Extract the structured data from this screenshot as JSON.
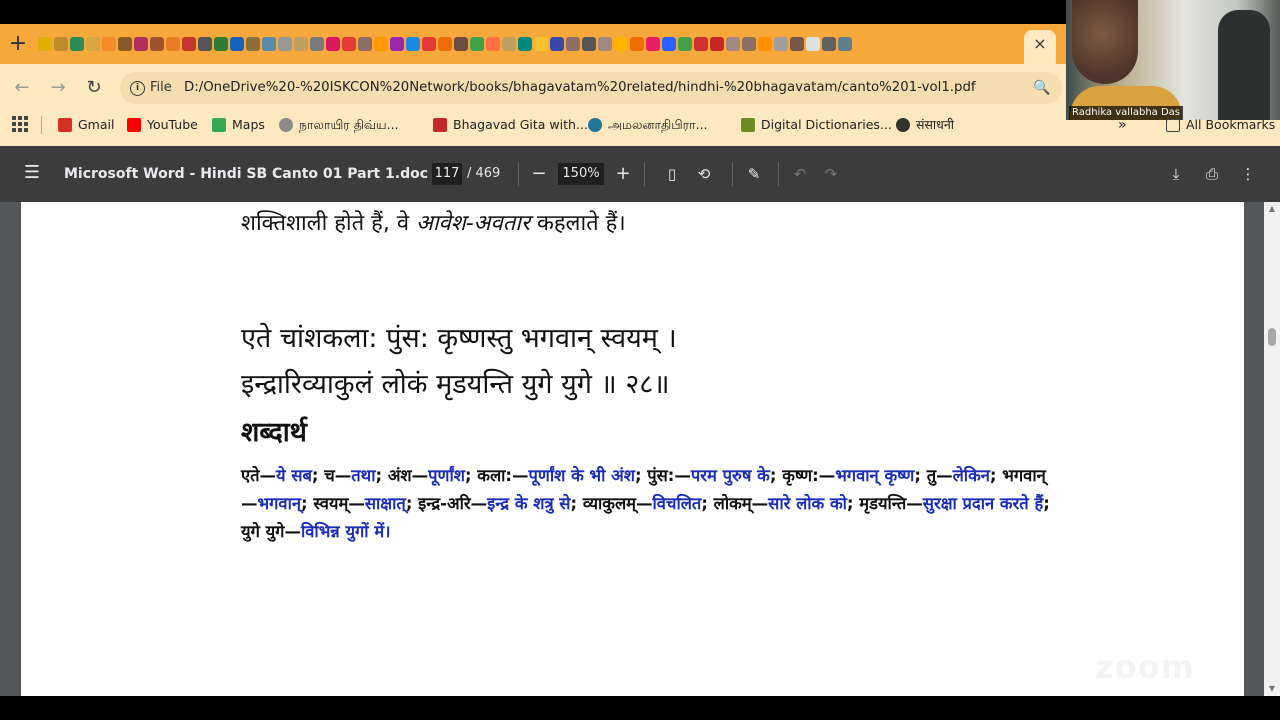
{
  "browser": {
    "tab_close": "×",
    "new_tab": "+",
    "address": {
      "chip_label": "File",
      "url": "D:/OneDrive%20-%20ISKCON%20Network/books/bhagavatam%20related/hindhi-%20bhagavatam/canto%201-vol1.pdf"
    },
    "bookmarks": [
      {
        "label": "Gmail",
        "icon": "gmail-icon",
        "color": "#d93025"
      },
      {
        "label": "YouTube",
        "icon": "youtube-icon",
        "color": "#ff0000"
      },
      {
        "label": "Maps",
        "icon": "maps-icon",
        "color": "#34a853"
      },
      {
        "label": "நாலாயிர திவ்ய...",
        "icon": "temple-icon",
        "color": "#8a8a8a"
      },
      {
        "label": "Bhagavad Gita with...",
        "icon": "flower-icon",
        "color": "#c62828"
      },
      {
        "label": "அமலனாதிபிரா...",
        "icon": "wordpress-icon",
        "color": "#21759b"
      },
      {
        "label": "Digital Dictionaries...",
        "icon": "dictionary-icon",
        "color": "#6b8e23"
      },
      {
        "label": "संसाधनी",
        "icon": "globe-icon",
        "color": "#333333"
      }
    ],
    "all_bookmarks": "All Bookmarks",
    "overflow": "»"
  },
  "video": {
    "participant_name": "Radhika vallabha Das",
    "watermark": "zoom"
  },
  "pdf_viewer": {
    "title": "Microsoft Word - Hindi SB Canto 01 Part 1.doc",
    "current_page": "117",
    "total_pages": "/ 469",
    "zoom": "150%"
  },
  "document": {
    "line1_before": "शक्तिशाली होते हैं, वे ",
    "line1_italic": "आवेश-अवतार",
    "line1_after": " कहलाते हैं।",
    "verse_line1": "एते चांशकला: पुंस: कृष्णस्तु भगवान् स्वयम् ।",
    "verse_line2": "इन्द्रारिव्याकुलं लोकं मृडयन्ति युगे युगे ॥ २८॥",
    "heading": "शब्दार्थ",
    "synonyms": [
      {
        "word": "एते",
        "meaning": "ये सब"
      },
      {
        "word": "च",
        "meaning": "तथा"
      },
      {
        "word": "अंश",
        "meaning": "पूर्णांश"
      },
      {
        "word": "कला:",
        "meaning": "पूर्णांश के भी अंश"
      },
      {
        "word": "पुंस:",
        "meaning": "परम पुरुष के"
      },
      {
        "word": "कृष्ण:",
        "meaning": "भगवान् कृष्ण"
      },
      {
        "word": "तु",
        "meaning": "लेकिन"
      },
      {
        "word": "भगवान्",
        "meaning": "भगवान्"
      },
      {
        "word": "स्वयम्",
        "meaning": "साक्षात्"
      },
      {
        "word": "इन्द्र-अरि",
        "meaning": "इन्द्र के शत्रु से"
      },
      {
        "word": "व्याकुलम्",
        "meaning": "विचलित"
      },
      {
        "word": "लोकम्",
        "meaning": "सारे लोक को"
      },
      {
        "word": "मृडयन्ति",
        "meaning": "सुरक्षा प्रदान करते हैं"
      },
      {
        "word": "युगे युगे",
        "meaning": "विभिन्न युगों में"
      }
    ],
    "meaning_color": "#1b2db8"
  }
}
